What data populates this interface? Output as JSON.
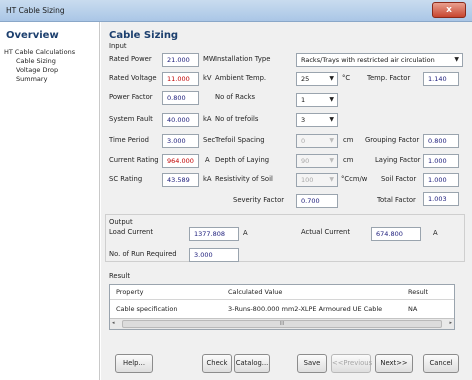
{
  "window": {
    "title": "HT Cable Sizing",
    "close": "x"
  },
  "sidebar": {
    "header": "Overview",
    "items": [
      {
        "label": "HT Cable Calculations"
      },
      {
        "label": "Cable Sizing"
      },
      {
        "label": "Voltage Drop"
      },
      {
        "label": "Summary"
      }
    ]
  },
  "main": {
    "header": "Cable Sizing",
    "input_label": "Input",
    "rated_power": {
      "label": "Rated Power",
      "value": "21.000",
      "unit": "MW"
    },
    "rated_voltage": {
      "label": "Rated Voltage",
      "value": "11.000",
      "unit": "kV"
    },
    "power_factor": {
      "label": "Power Factor",
      "value": "0.800"
    },
    "system_fault": {
      "label": "System Fault",
      "value": "40.000",
      "unit": "kA"
    },
    "time_period": {
      "label": "Time Period",
      "value": "3.000",
      "unit": "Sec"
    },
    "current_rating": {
      "label": "Current Rating",
      "value": "964.000",
      "unit": "A"
    },
    "sc_rating": {
      "label": "SC Rating",
      "value": "43.589",
      "unit": "kA"
    },
    "installation_type": {
      "label": "Installation Type",
      "value": "Racks/Trays with restricted air circulation"
    },
    "ambient_temp": {
      "label": "Ambient Temp.",
      "value": "25",
      "unit": "°C"
    },
    "temp_factor": {
      "label": "Temp. Factor",
      "value": "1.140"
    },
    "no_of_racks": {
      "label": "No of Racks",
      "value": "1"
    },
    "no_of_trefoils": {
      "label": "No of trefoils",
      "value": "3"
    },
    "trefoil_spacing": {
      "label": "Trefoil Spacing",
      "value": "0",
      "unit": "cm"
    },
    "grouping_factor": {
      "label": "Grouping Factor",
      "value": "0.800"
    },
    "depth_of_laying": {
      "label": "Depth of Laying",
      "value": "90",
      "unit": "cm"
    },
    "laying_factor": {
      "label": "Laying Factor",
      "value": "1.000"
    },
    "resistivity_of_soil": {
      "label": "Resistivity of Soil",
      "value": "100",
      "unit": "°Ccm/w"
    },
    "soil_factor": {
      "label": "Soil Factor",
      "value": "1.000"
    },
    "severity_factor": {
      "label": "Severity Factor",
      "value": "0.700"
    },
    "total_factor": {
      "label": "Total Factor",
      "value": "1.003"
    },
    "output": {
      "label": "Output",
      "load_current": {
        "label": "Load Current",
        "value": "1377.808",
        "unit": "A"
      },
      "actual_current": {
        "label": "Actual Current",
        "value": "674.800",
        "unit": "A"
      },
      "runs_required": {
        "label": "No. of Run Required",
        "value": "3.000"
      }
    },
    "result": {
      "label": "Result",
      "columns": [
        "Property",
        "Calculated Value",
        "Result"
      ],
      "rows": [
        [
          "Cable specification",
          "3-Runs-800.000 mm2-XLPE Armoured UE Cable",
          "NA"
        ]
      ],
      "scroll_left": "◂",
      "scroll_thumb": "III",
      "scroll_right": "▸"
    }
  },
  "buttons": {
    "help": "Help...",
    "check": "Check",
    "catalog": "Catalog...",
    "save": "Save",
    "previous": "<<Previous",
    "next": "Next>>",
    "cancel": "Cancel"
  },
  "dropdown_arrow": "▼"
}
